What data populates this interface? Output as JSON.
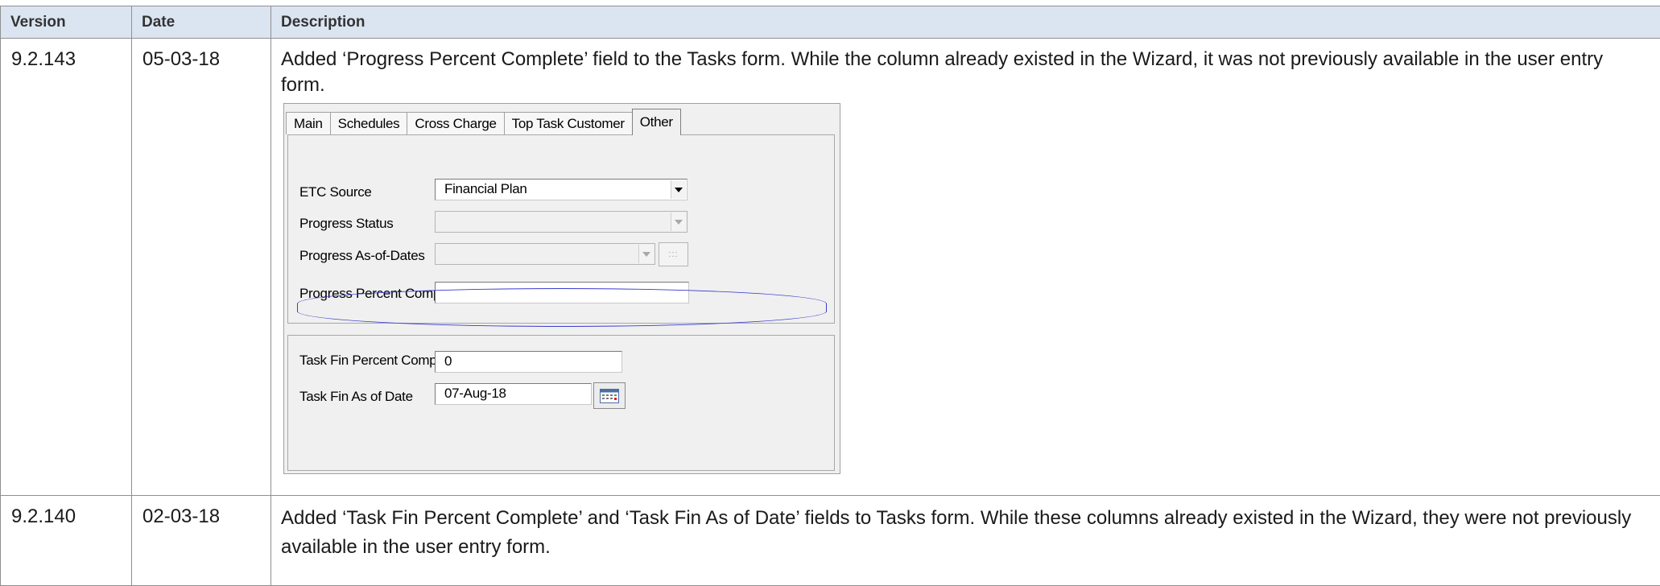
{
  "table": {
    "headers": {
      "version": "Version",
      "date": "Date",
      "description": "Description"
    },
    "rows": [
      {
        "version": "9.2.143",
        "date": "05-03-18",
        "description": "Added ‘Progress Percent Complete’ field to the Tasks form.  While the column already existed in the Wizard, it was not previously available in the user entry form."
      },
      {
        "version": "9.2.140",
        "date": "02-03-18",
        "description": "Added ‘Task Fin Percent Complete’ and ‘Task Fin As of Date’ fields to Tasks form.  While these columns already existed in the Wizard, they were not previously available in the user entry form."
      }
    ]
  },
  "dialog": {
    "tabs": [
      "Main",
      "Schedules",
      "Cross Charge",
      "Top Task Customer",
      "Other"
    ],
    "active_tab": "Other",
    "etc_source": {
      "label": "ETC Source",
      "value": "Financial Plan"
    },
    "progress_status": {
      "label": "Progress Status",
      "value": ""
    },
    "progress_as_of_dates": {
      "label": "Progress As-of-Dates",
      "value": "",
      "button": ":::"
    },
    "progress_percent_complete": {
      "label": "Progress Percent Complete",
      "value": ""
    },
    "task_fin_percent_complete": {
      "label": "Task Fin Percent Complete",
      "value": "0"
    },
    "task_fin_as_of_date": {
      "label": "Task Fin As of Date",
      "value": "07-Aug-18"
    },
    "highlight_color": "#3a3acf"
  },
  "colors": {
    "header_bg": "#dbe5f1",
    "grid": "#8f8f8f"
  }
}
